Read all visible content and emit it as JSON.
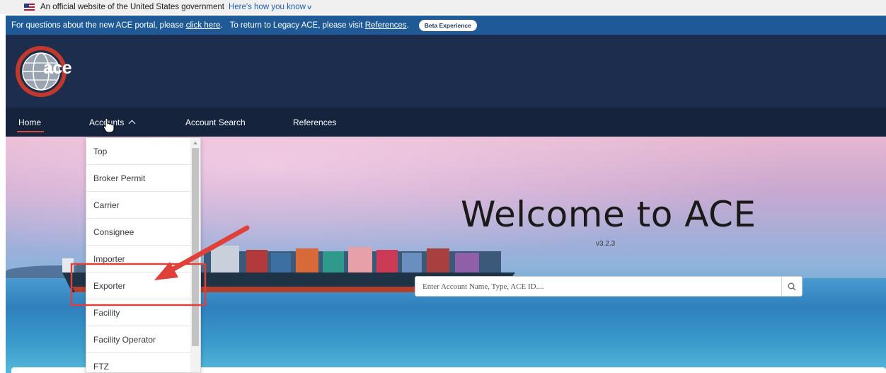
{
  "gov_banner": {
    "text": "An official website of the United States government",
    "link": "Here's how you know"
  },
  "notice": {
    "text_1": "For questions about the new ACE portal, please",
    "link_1": "click here",
    "text_2": "To return to Legacy ACE, please visit",
    "link_2": "References",
    "badge": "Beta Experience"
  },
  "header": {
    "logo_text": "ace"
  },
  "nav": {
    "home": "Home",
    "accounts": "Accounts",
    "account_search": "Account Search",
    "references": "References"
  },
  "hero": {
    "title": "Welcome to ACE",
    "version": "v3.2.3",
    "search_placeholder": "Enter Account Name, Type, ACE ID...."
  },
  "dropdown": {
    "items": [
      {
        "label": "Top"
      },
      {
        "label": "Broker Permit"
      },
      {
        "label": "Carrier"
      },
      {
        "label": "Consignee"
      },
      {
        "label": "Importer"
      },
      {
        "label": "Exporter"
      },
      {
        "label": "Facility"
      },
      {
        "label": "Facility Operator"
      },
      {
        "label": "FTZ"
      }
    ]
  },
  "colors": {
    "notice_bg": "#1f5a96",
    "header_bg": "#1d2d4e",
    "nav_bg": "#16233d",
    "active_underline": "#d84a3c",
    "annotation_red": "#e0403a"
  },
  "icons": {
    "flag": "us-flag-icon",
    "search": "search-icon",
    "cursor": "hand-pointer-icon"
  }
}
